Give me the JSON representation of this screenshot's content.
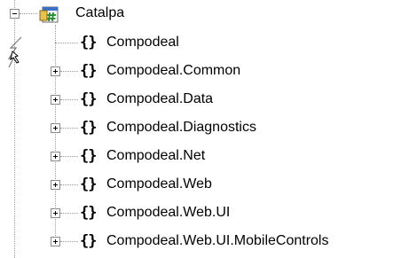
{
  "tree": {
    "root": {
      "label": "Catalpa",
      "expanded": true,
      "icon": "csharp-project-icon"
    },
    "namespaces": [
      {
        "label": "Compodeal",
        "has_children": false,
        "icon": "namespace-icon"
      },
      {
        "label": "Compodeal.Common",
        "has_children": true,
        "expander": "+",
        "icon": "namespace-icon"
      },
      {
        "label": "Compodeal.Data",
        "has_children": true,
        "expander": "+",
        "icon": "namespace-icon"
      },
      {
        "label": "Compodeal.Diagnostics",
        "has_children": true,
        "expander": "+",
        "icon": "namespace-icon"
      },
      {
        "label": "Compodeal.Net",
        "has_children": true,
        "expander": "+",
        "icon": "namespace-icon"
      },
      {
        "label": "Compodeal.Web",
        "has_children": true,
        "expander": "+",
        "icon": "namespace-icon"
      },
      {
        "label": "Compodeal.Web.UI",
        "has_children": true,
        "expander": "+",
        "icon": "namespace-icon"
      },
      {
        "label": "Compodeal.Web.UI.MobileControls",
        "has_children": true,
        "expander": "+",
        "icon": "namespace-icon"
      }
    ],
    "namespace_glyph": "{}",
    "colors": {
      "tree_line": "#9a9a9a",
      "expander_border": "#8c8c8c",
      "text": "#000000"
    }
  }
}
